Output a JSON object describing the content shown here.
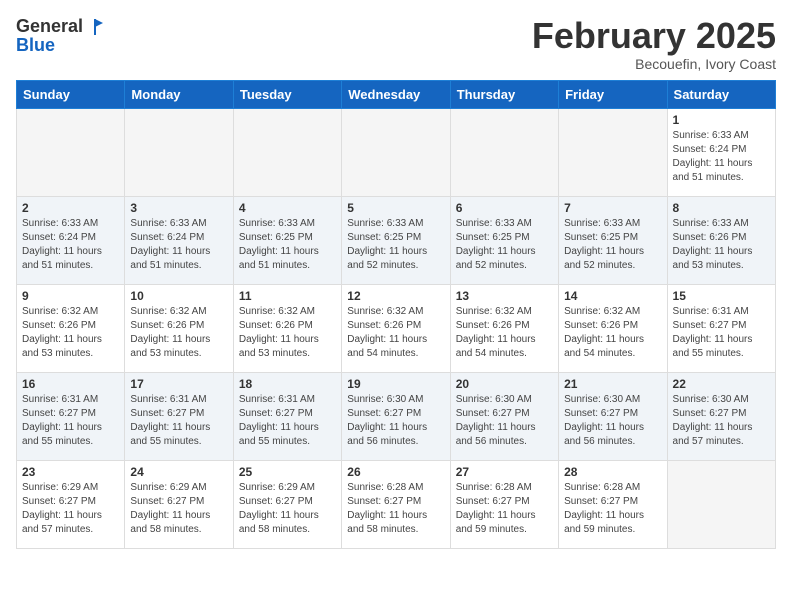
{
  "header": {
    "logo_line1": "General",
    "logo_line2": "Blue",
    "month": "February 2025",
    "location": "Becouefin, Ivory Coast"
  },
  "days_of_week": [
    "Sunday",
    "Monday",
    "Tuesday",
    "Wednesday",
    "Thursday",
    "Friday",
    "Saturday"
  ],
  "weeks": [
    [
      {
        "day": "",
        "info": ""
      },
      {
        "day": "",
        "info": ""
      },
      {
        "day": "",
        "info": ""
      },
      {
        "day": "",
        "info": ""
      },
      {
        "day": "",
        "info": ""
      },
      {
        "day": "",
        "info": ""
      },
      {
        "day": "1",
        "info": "Sunrise: 6:33 AM\nSunset: 6:24 PM\nDaylight: 11 hours and 51 minutes."
      }
    ],
    [
      {
        "day": "2",
        "info": "Sunrise: 6:33 AM\nSunset: 6:24 PM\nDaylight: 11 hours and 51 minutes."
      },
      {
        "day": "3",
        "info": "Sunrise: 6:33 AM\nSunset: 6:24 PM\nDaylight: 11 hours and 51 minutes."
      },
      {
        "day": "4",
        "info": "Sunrise: 6:33 AM\nSunset: 6:25 PM\nDaylight: 11 hours and 51 minutes."
      },
      {
        "day": "5",
        "info": "Sunrise: 6:33 AM\nSunset: 6:25 PM\nDaylight: 11 hours and 52 minutes."
      },
      {
        "day": "6",
        "info": "Sunrise: 6:33 AM\nSunset: 6:25 PM\nDaylight: 11 hours and 52 minutes."
      },
      {
        "day": "7",
        "info": "Sunrise: 6:33 AM\nSunset: 6:25 PM\nDaylight: 11 hours and 52 minutes."
      },
      {
        "day": "8",
        "info": "Sunrise: 6:33 AM\nSunset: 6:26 PM\nDaylight: 11 hours and 53 minutes."
      }
    ],
    [
      {
        "day": "9",
        "info": "Sunrise: 6:32 AM\nSunset: 6:26 PM\nDaylight: 11 hours and 53 minutes."
      },
      {
        "day": "10",
        "info": "Sunrise: 6:32 AM\nSunset: 6:26 PM\nDaylight: 11 hours and 53 minutes."
      },
      {
        "day": "11",
        "info": "Sunrise: 6:32 AM\nSunset: 6:26 PM\nDaylight: 11 hours and 53 minutes."
      },
      {
        "day": "12",
        "info": "Sunrise: 6:32 AM\nSunset: 6:26 PM\nDaylight: 11 hours and 54 minutes."
      },
      {
        "day": "13",
        "info": "Sunrise: 6:32 AM\nSunset: 6:26 PM\nDaylight: 11 hours and 54 minutes."
      },
      {
        "day": "14",
        "info": "Sunrise: 6:32 AM\nSunset: 6:26 PM\nDaylight: 11 hours and 54 minutes."
      },
      {
        "day": "15",
        "info": "Sunrise: 6:31 AM\nSunset: 6:27 PM\nDaylight: 11 hours and 55 minutes."
      }
    ],
    [
      {
        "day": "16",
        "info": "Sunrise: 6:31 AM\nSunset: 6:27 PM\nDaylight: 11 hours and 55 minutes."
      },
      {
        "day": "17",
        "info": "Sunrise: 6:31 AM\nSunset: 6:27 PM\nDaylight: 11 hours and 55 minutes."
      },
      {
        "day": "18",
        "info": "Sunrise: 6:31 AM\nSunset: 6:27 PM\nDaylight: 11 hours and 55 minutes."
      },
      {
        "day": "19",
        "info": "Sunrise: 6:30 AM\nSunset: 6:27 PM\nDaylight: 11 hours and 56 minutes."
      },
      {
        "day": "20",
        "info": "Sunrise: 6:30 AM\nSunset: 6:27 PM\nDaylight: 11 hours and 56 minutes."
      },
      {
        "day": "21",
        "info": "Sunrise: 6:30 AM\nSunset: 6:27 PM\nDaylight: 11 hours and 56 minutes."
      },
      {
        "day": "22",
        "info": "Sunrise: 6:30 AM\nSunset: 6:27 PM\nDaylight: 11 hours and 57 minutes."
      }
    ],
    [
      {
        "day": "23",
        "info": "Sunrise: 6:29 AM\nSunset: 6:27 PM\nDaylight: 11 hours and 57 minutes."
      },
      {
        "day": "24",
        "info": "Sunrise: 6:29 AM\nSunset: 6:27 PM\nDaylight: 11 hours and 58 minutes."
      },
      {
        "day": "25",
        "info": "Sunrise: 6:29 AM\nSunset: 6:27 PM\nDaylight: 11 hours and 58 minutes."
      },
      {
        "day": "26",
        "info": "Sunrise: 6:28 AM\nSunset: 6:27 PM\nDaylight: 11 hours and 58 minutes."
      },
      {
        "day": "27",
        "info": "Sunrise: 6:28 AM\nSunset: 6:27 PM\nDaylight: 11 hours and 59 minutes."
      },
      {
        "day": "28",
        "info": "Sunrise: 6:28 AM\nSunset: 6:27 PM\nDaylight: 11 hours and 59 minutes."
      },
      {
        "day": "",
        "info": ""
      }
    ]
  ]
}
